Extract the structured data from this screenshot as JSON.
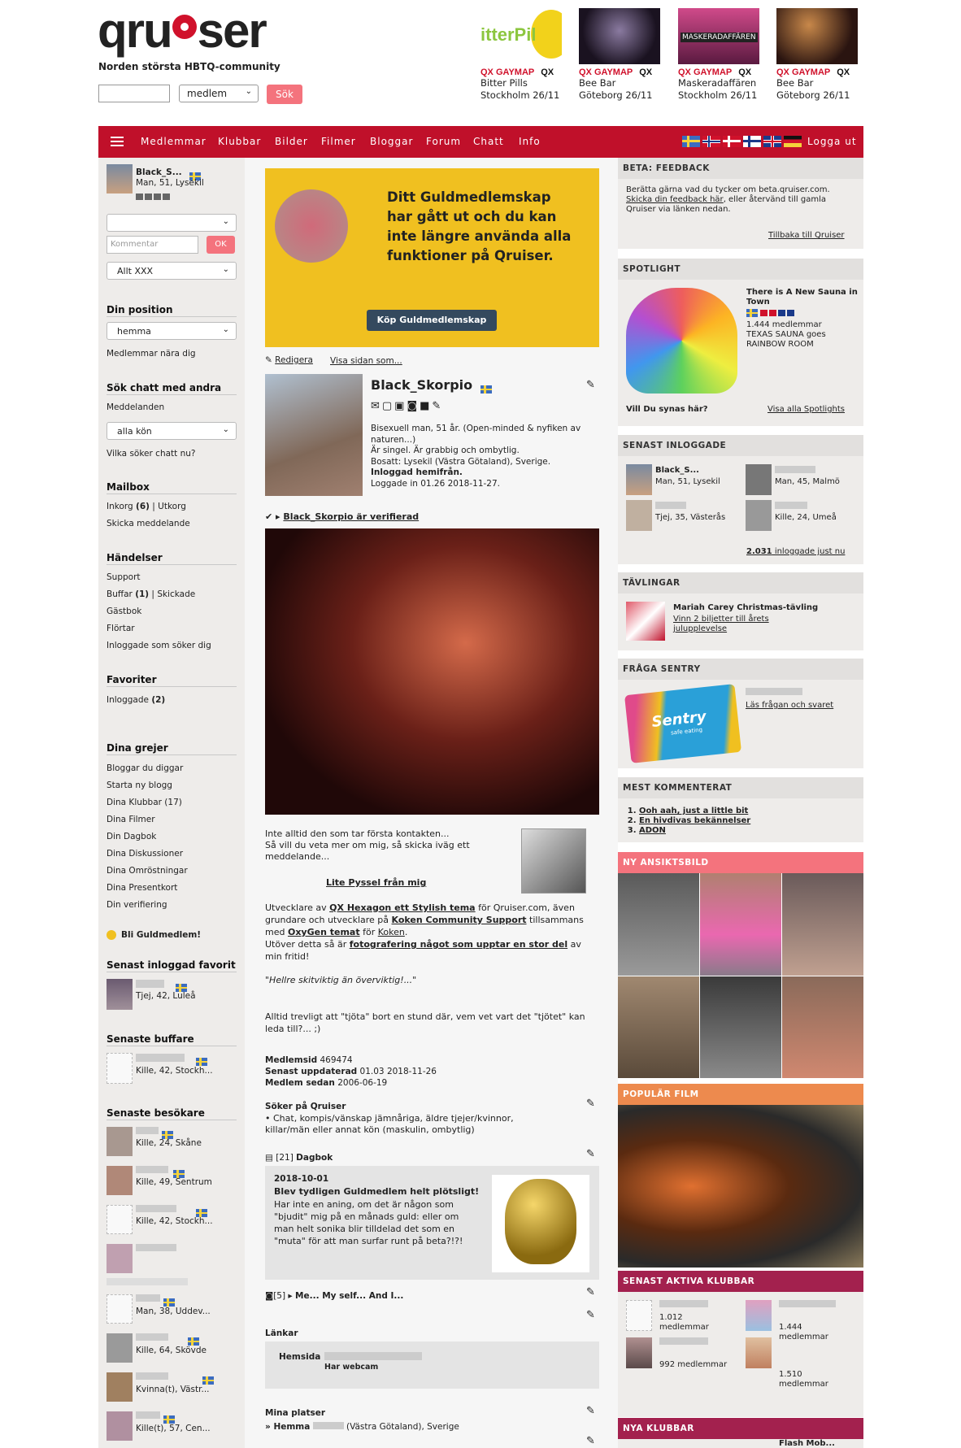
{
  "header": {
    "logo": "qruiser",
    "tagline": "Norden största HBTQ-community",
    "search_select": "medlem",
    "search_btn": "Sök",
    "ads": [
      {
        "label": "QX GAYMAP",
        "mark": "QX",
        "line1": "Bitter Pills",
        "line2": "Stockholm 26/11",
        "img": "itterPil"
      },
      {
        "label": "QX GAYMAP",
        "mark": "QX",
        "line1": "Bee Bar",
        "line2": "Göteborg 26/11",
        "img": ""
      },
      {
        "label": "QX GAYMAP",
        "mark": "QX",
        "line1": "Maskeradaffären",
        "line2": "Stockholm 26/11",
        "img": "MASKERADAFFÄREN"
      },
      {
        "label": "QX GAYMAP",
        "mark": "QX",
        "line1": "Bee Bar",
        "line2": "Göteborg 26/11",
        "img": ""
      }
    ]
  },
  "nav": {
    "items": [
      "Medlemmar",
      "Klubbar",
      "Bilder",
      "Filmer",
      "Bloggar",
      "Forum",
      "Chatt",
      "Info"
    ],
    "logout": "Logga ut"
  },
  "left": {
    "user": {
      "name": "Black_S...",
      "info": "Man, 51, Lysekil"
    },
    "comment_placeholder": "Kommentar",
    "ok": "OK",
    "filter": "Allt XXX",
    "position_title": "Din position",
    "position_value": "hemma",
    "nearby": "Medlemmar nära dig",
    "chat_title": "Sök chatt med andra",
    "messages": "Meddelanden",
    "gender": "alla kön",
    "who_chat": "Vilka söker chatt nu?",
    "mailbox_title": "Mailbox",
    "inbox": "Inkorg",
    "inbox_count": "(6)",
    "outbox": "Utkorg",
    "send": "Skicka meddelande",
    "events_title": "Händelser",
    "support": "Support",
    "buffar": "Buffar",
    "buffar_count": "(1)",
    "sent": "Skickade",
    "guestbook": "Gästbok",
    "flirts": "Flörtar",
    "online_search": "Inloggade som söker dig",
    "fav_title": "Favoriter",
    "fav_online": "Inloggade",
    "fav_count": "(2)",
    "stuff_title": "Dina grejer",
    "stuff": [
      "Bloggar du diggar",
      "Starta ny blogg",
      "Dina Klubbar (17)",
      "Dina Filmer",
      "Din Dagbok",
      "Dina Diskussioner",
      "Dina Omröstningar",
      "Dina Presentkort",
      "Din verifiering"
    ],
    "gold": "Bli Guldmedlem!",
    "last_fav_title": "Senast inloggad favorit",
    "last_fav": "Tjej, 42, Luleå",
    "last_buff_title": "Senaste buffare",
    "last_buff": "Kille, 42, Stockh...",
    "visitors_title": "Senaste besökare",
    "visitors": [
      "Kille, 24, Skåne",
      "Kille, 49, Sentrum",
      "Kille, 42, Stockh...",
      "",
      "Man, 38, Uddev...",
      "Kille, 64, Skövde",
      "Kvinna(t), Västr...",
      "Kille(t), 57, Cen..."
    ]
  },
  "main": {
    "gold_msg": "Ditt Guldmedlemskap har gått ut och du kan inte längre använda alla funktioner på Qruiser.",
    "gold_btn": "Köp Guldmedlemskap",
    "edit": "Redigera",
    "view_as": "Visa sidan som...",
    "name": "Black_Skorpio",
    "p1": "Bisexuell man, 51 år. (Open-minded & nyfiken av naturen...)",
    "p2": "Är singel. Är grabbig och ombytlig.",
    "p3": "Bosatt: Lysekil (Västra Götaland), Sverige.",
    "p4": "Inloggad hemifrån.",
    "p5": "Loggade in 01.26 2018-11-27.",
    "verified": "Black_Skorpio är verifierad",
    "bio1": "Inte alltid den som tar första kontakten...",
    "bio2": "Så vill du veta mer om mig, så skicka iväg ett meddelande...",
    "pyssel": "Lite Pyssel från mig",
    "dev_pre": "Utvecklare av ",
    "dev_link1": "QX Hexagon ett Stylish tema",
    "dev_mid1": " för Qruiser.com, även grundare och utvecklare på ",
    "dev_link2": "Koken Community Support",
    "dev_mid2": " tillsammans med ",
    "dev_link3": "OxyGen temat",
    "dev_mid3": " för ",
    "dev_link4": "Koken",
    "dev_mid4": ".",
    "dev_l2": "Utöver detta så är ",
    "dev_link5": "fotografering något som upptar en stor del",
    "dev_end": " av min fritid!",
    "quote": "\"Hellre skitviktig än överviktig!...\"",
    "bio3": "Alltid trevligt att \"tjöta\" bort en stund där, vem vet vart det \"tjötet\" kan leda till?... ;)",
    "mid_label": "Medlemsid",
    "mid": "469474",
    "upd_label": "Senast uppdaterad",
    "upd": "01.03 2018-11-26",
    "since_label": "Medlem sedan",
    "since": "2006-06-19",
    "seek_title": "Söker på Qruiser",
    "seek_text": "• Chat, kompis/vänskap jämnåriga, äldre tjejer/kvinnor, killar/män eller annat kön (maskulin, ombytlig)",
    "diary_count": "[21]",
    "diary_title": "Dagbok",
    "diary_date": "2018-10-01",
    "diary_head": "Blev tydligen Guldmedlem helt plötsligt!",
    "diary_text": "Har inte en aning, om det är någon som \"bjudit\" mig på en månads guld: eller om man helt sonika blir tilldelad det som en \"muta\" för att man surfar runt på beta?!?!",
    "album_count": "[5]",
    "album_title": "Me... My self... And I...",
    "links_title": "Länkar",
    "hemsida": "Hemsida",
    "webcam": "Har webcam",
    "places_title": "Mina platser",
    "home_label": "» Hemma",
    "home_loc": "(Västra Götaland), Sverige"
  },
  "right": {
    "beta_title": "BETA: FEEDBACK",
    "beta_text1": "Berätta gärna vad du tycker om beta.qruiser.com.",
    "beta_link": "Skicka din feedback här",
    "beta_text2": ", eller återvänd till gamla Qruiser via länken nedan.",
    "beta_back": "Tillbaka till Qruiser",
    "spot_title": "SPOTLIGHT",
    "spot_name": "There is A New Sauna in Town",
    "spot_members": "1.444 medlemmar",
    "spot_desc": "TEXAS SAUNA goes RAINBOW ROOM",
    "spot_q": "Vill Du synas här?",
    "spot_all": "Visa alla Spotlights",
    "online_title": "SENAST INLOGGADE",
    "online": [
      {
        "name": "Black_S...",
        "info": "Man, 51, Lysekil"
      },
      {
        "name": "",
        "info": "Man, 45, Malmö"
      },
      {
        "name": "",
        "info": "Tjej, 35, Västerås"
      },
      {
        "name": "",
        "info": "Kille, 24, Umeå"
      }
    ],
    "online_count": "2.031",
    "online_suffix": " inloggade just nu",
    "comp_title": "TÄVLINGAR",
    "comp_name": "Mariah Carey Christmas-tävling",
    "comp_link": "Vinn 2 biljetter till årets julupplevelse",
    "sentry_title": "FRÅGA SENTRY",
    "sentry_logo": "Sentry",
    "sentry_sub": "safe eating",
    "sentry_link": "Läs frågan och svaret",
    "comm_title": "MEST KOMMENTERAT",
    "comm": [
      "Ooh aah, just a little bit",
      "En hivdivas bekännelser",
      "ADON"
    ],
    "face_title": "NY ANSIKTSBILD",
    "film_title": "POPULÄR FILM",
    "clubs_title": "SENAST AKTIVA KLUBBAR",
    "clubs": [
      "1.012 medlemmar",
      "1.444 medlemmar",
      "992 medlemmar",
      "1.510 medlemmar"
    ],
    "new_title": "NYA KLUBBAR",
    "new_club": "Flash Mob..."
  },
  "colors": {
    "brand": "#c0102a",
    "gold": "#f0c020",
    "accent": "#f4737d"
  }
}
